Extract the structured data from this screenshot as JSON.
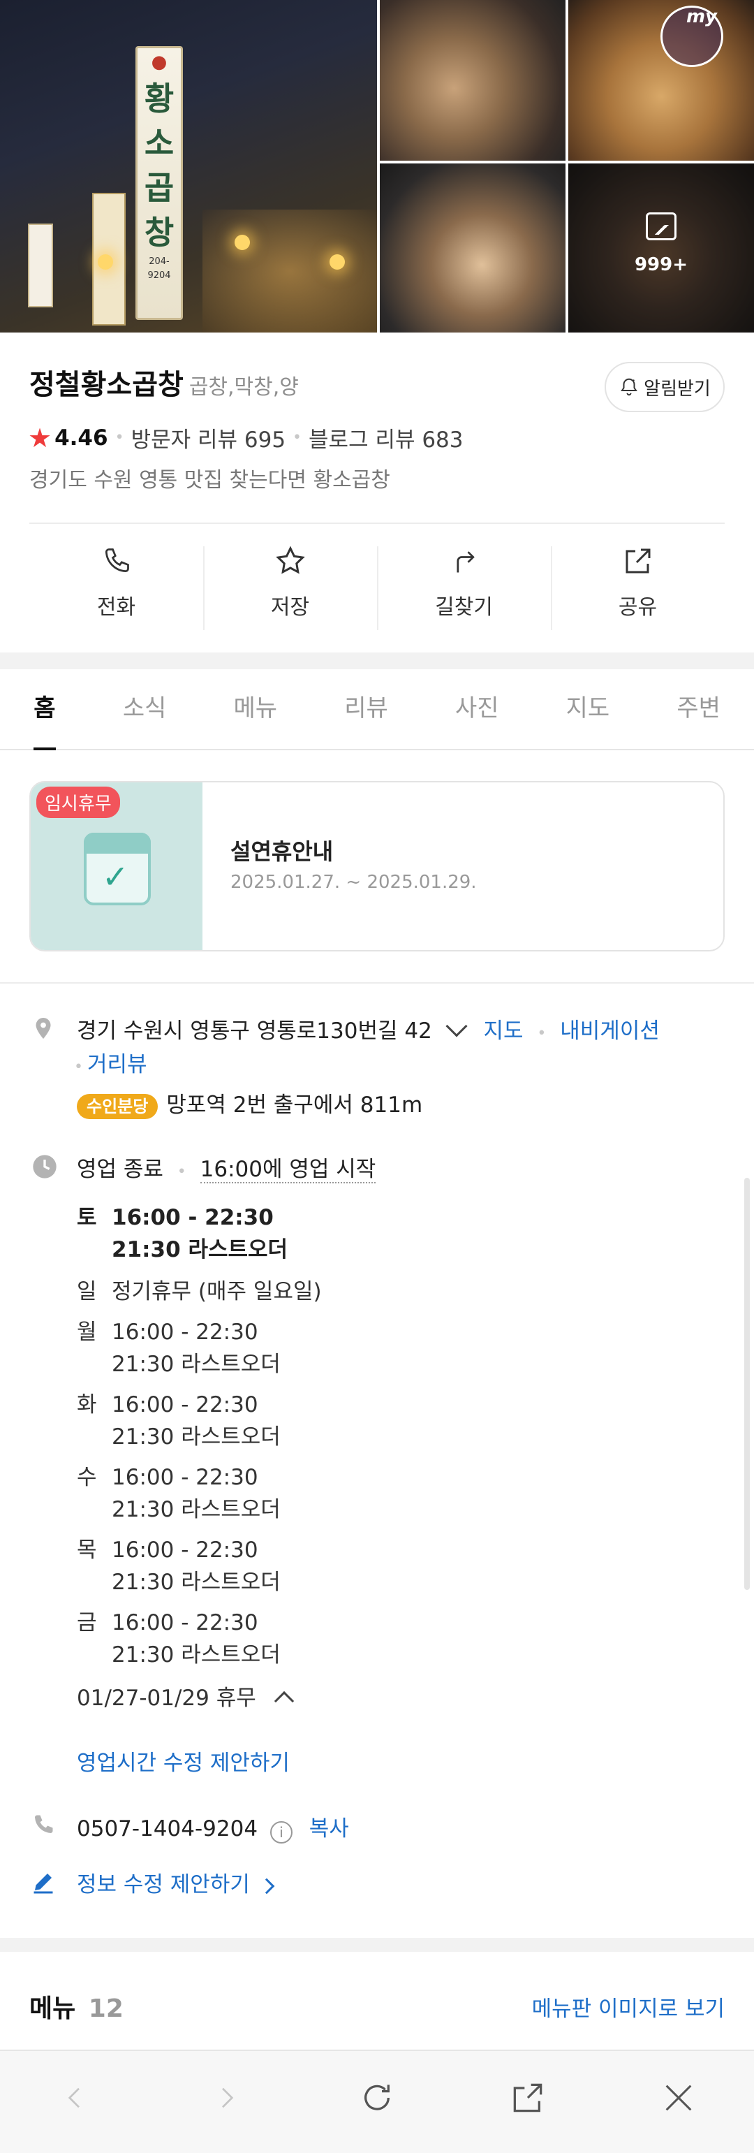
{
  "photos": {
    "more_count": "999+",
    "my_badge": "my",
    "sign_text": [
      "황",
      "소",
      "곱",
      "창"
    ],
    "sign_phone": "204-9204"
  },
  "place": {
    "name": "정철황소곱창",
    "category": "곱창,막창,양",
    "alarm_label": "알림받기",
    "rating": "4.46",
    "visitor_reviews": "방문자 리뷰 695",
    "blog_reviews": "블로그 리뷰 683",
    "description": "경기도 수원 영통 맛집 찾는다면 황소곱창"
  },
  "actions": [
    {
      "label": "전화",
      "icon": "phone-icon"
    },
    {
      "label": "저장",
      "icon": "star-icon"
    },
    {
      "label": "길찾기",
      "icon": "directions-icon"
    },
    {
      "label": "공유",
      "icon": "share-icon"
    }
  ],
  "tabs": [
    "홈",
    "소식",
    "메뉴",
    "리뷰",
    "사진",
    "지도",
    "주변"
  ],
  "notice": {
    "badge": "임시휴무",
    "title": "설연휴안내",
    "dates": "2025.01.27. ~ 2025.01.29."
  },
  "address": {
    "text": "경기 수원시 영통구 영통로130번길 42",
    "map_link": "지도",
    "nav_link": "내비게이션",
    "distance_link": "거리뷰",
    "station_badge": "수인분당",
    "station_text": "망포역 2번 출구에서 811m"
  },
  "hours": {
    "status": "영업 종료",
    "next": "16:00에 영업 시작",
    "days": [
      {
        "day": "토",
        "line1": "16:00 - 22:30",
        "line2": "21:30 라스트오더"
      },
      {
        "day": "일",
        "line1": "정기휴무 (매주 일요일)",
        "line2": ""
      },
      {
        "day": "월",
        "line1": "16:00 - 22:30",
        "line2": "21:30 라스트오더"
      },
      {
        "day": "화",
        "line1": "16:00 - 22:30",
        "line2": "21:30 라스트오더"
      },
      {
        "day": "수",
        "line1": "16:00 - 22:30",
        "line2": "21:30 라스트오더"
      },
      {
        "day": "목",
        "line1": "16:00 - 22:30",
        "line2": "21:30 라스트오더"
      },
      {
        "day": "금",
        "line1": "16:00 - 22:30",
        "line2": "21:30 라스트오더"
      }
    ],
    "holiday": "01/27-01/29 휴무",
    "suggest_link": "영업시간 수정 제안하기"
  },
  "phone": {
    "number": "0507-1404-9204",
    "copy_label": "복사"
  },
  "edit_link": "정보 수정 제안하기",
  "menu_section": {
    "title": "메뉴",
    "count": "12",
    "image_link": "메뉴판 이미지로 보기"
  },
  "colors": {
    "accent_blue": "#1e6ec8",
    "star_red": "#ef3b3b",
    "badge_red": "#f2545b",
    "station_orange": "#f0a91a"
  }
}
